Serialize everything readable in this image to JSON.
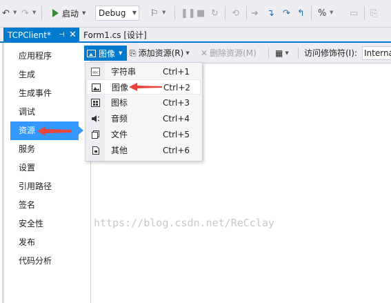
{
  "toolbar": {
    "start_label": "启动",
    "configuration": "Debug"
  },
  "tabs": {
    "active": "TCPClient*",
    "inactive": "Form1.cs [设计]"
  },
  "sidebar": {
    "items": [
      {
        "label": "应用程序"
      },
      {
        "label": "生成"
      },
      {
        "label": "生成事件"
      },
      {
        "label": "调试"
      },
      {
        "label": "资源",
        "selected": true
      },
      {
        "label": "服务"
      },
      {
        "label": "设置"
      },
      {
        "label": "引用路径"
      },
      {
        "label": "签名"
      },
      {
        "label": "安全性"
      },
      {
        "label": "发布"
      },
      {
        "label": "代码分析"
      }
    ]
  },
  "resource_toolbar": {
    "type_button": "图像",
    "add_resource": "添加资源(R)",
    "remove_resource": "删除资源(M)",
    "access_modifier_label": "访问修饰符(I):",
    "access_modifier_value": "Internal"
  },
  "menu": {
    "items": [
      {
        "label": "字符串",
        "shortcut": "Ctrl+1",
        "icon": "string-icon"
      },
      {
        "label": "图像",
        "shortcut": "Ctrl+2",
        "icon": "image-icon"
      },
      {
        "label": "图标",
        "shortcut": "Ctrl+3",
        "icon": "icon-icon"
      },
      {
        "label": "音频",
        "shortcut": "Ctrl+4",
        "icon": "audio-icon"
      },
      {
        "label": "文件",
        "shortcut": "Ctrl+5",
        "icon": "file-icon"
      },
      {
        "label": "其他",
        "shortcut": "Ctrl+6",
        "icon": "other-icon"
      }
    ]
  },
  "watermark": "https://blog.csdn.net/ReCclay",
  "colors": {
    "accent": "#007acc",
    "selection": "#3399ff",
    "annotation": "#e8453c"
  }
}
